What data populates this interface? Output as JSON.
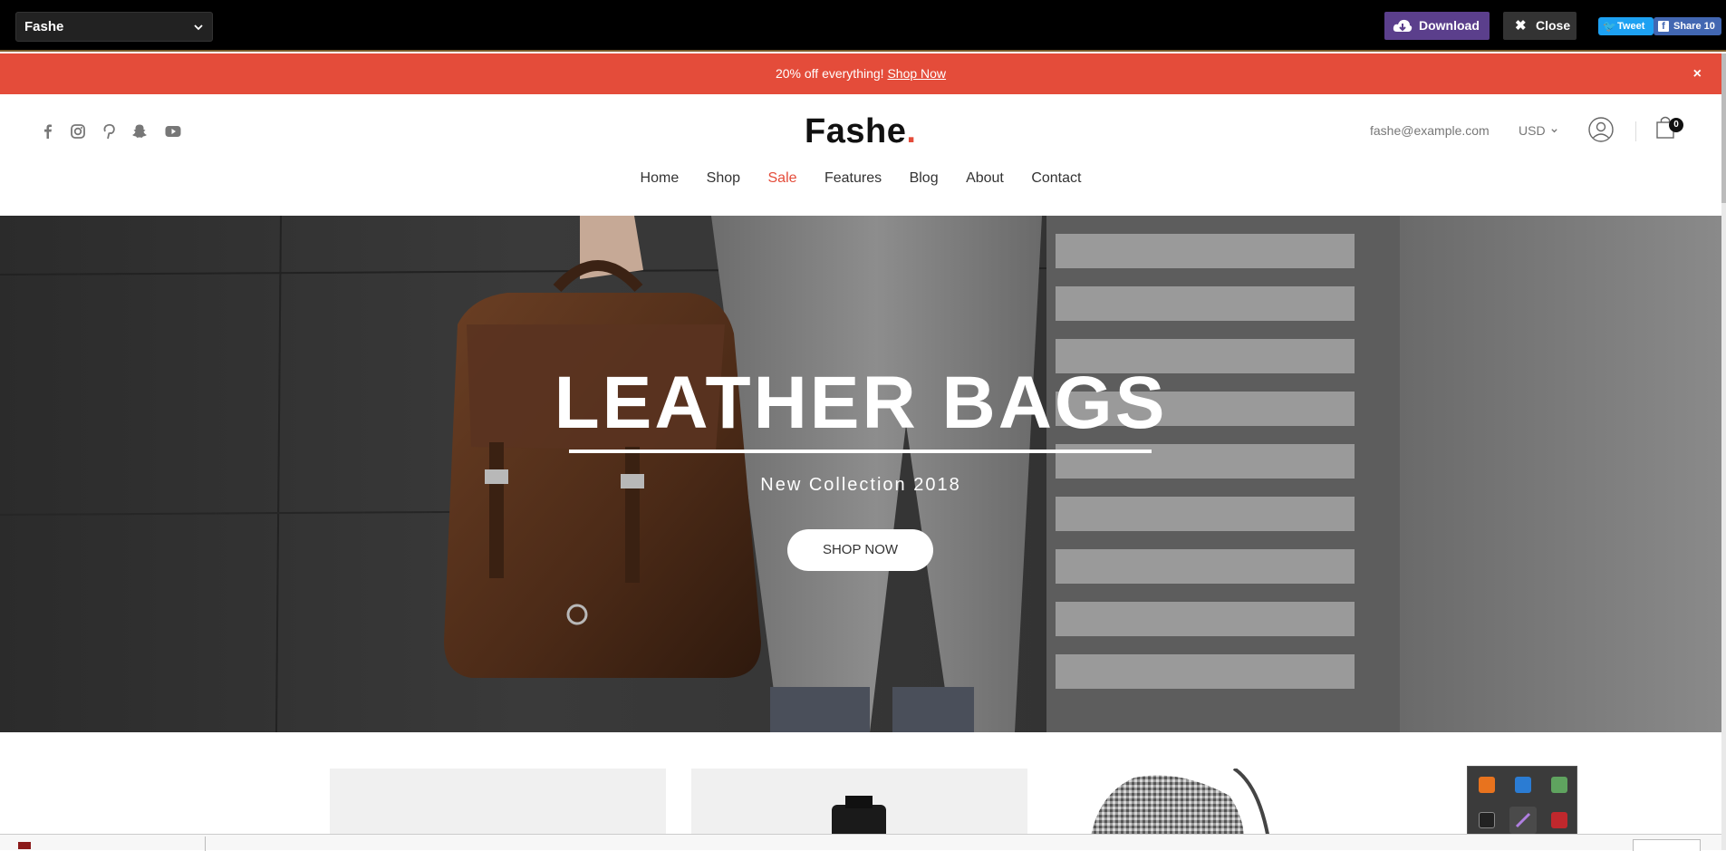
{
  "topbar": {
    "theme_name": "Fashe",
    "download_label": "Download",
    "close_label": "Close",
    "tweet_label": "Tweet",
    "share_label": "Share 10"
  },
  "promo": {
    "text": "20% off everything!",
    "link": "Shop Now",
    "close": "×"
  },
  "header": {
    "socials": [
      "facebook-icon",
      "instagram-icon",
      "pinterest-icon",
      "snapchat-icon",
      "youtube-icon"
    ],
    "logo_text": "Fashe",
    "logo_dot": ".",
    "email": "fashe@example.com",
    "currency": "USD",
    "cart_count": "0"
  },
  "nav": {
    "items": [
      "Home",
      "Shop",
      "Sale",
      "Features",
      "Blog",
      "About",
      "Contact"
    ]
  },
  "hero": {
    "title": "LEATHER BAGS",
    "subtitle": "New Collection 2018",
    "button": "SHOP NOW"
  },
  "colors": {
    "accent": "#e44c3a",
    "topbar": "#000000",
    "download": "#5b3f8c"
  }
}
